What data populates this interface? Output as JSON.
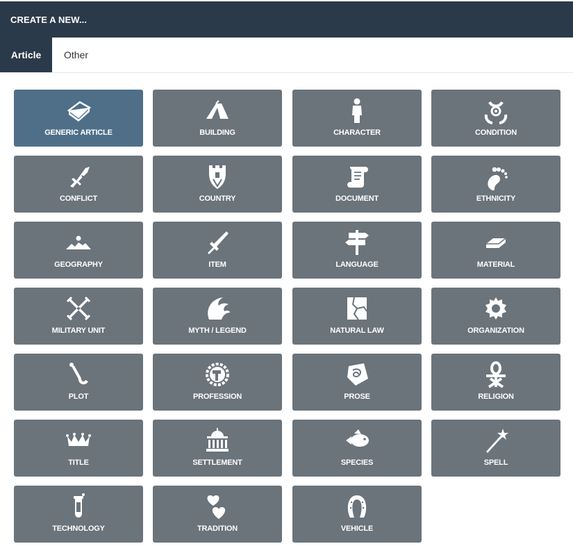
{
  "header": {
    "title": "CREATE A NEW..."
  },
  "tabs": [
    {
      "label": "Article",
      "active": true
    },
    {
      "label": "Other",
      "active": false
    }
  ],
  "colors": {
    "header_bg": "#2b3a4a",
    "tile_bg": "#6b737b",
    "tile_selected_bg": "#4f6f89"
  },
  "tiles": [
    {
      "label": "GENERIC ARTICLE",
      "icon": "book-icon",
      "selected": true
    },
    {
      "label": "BUILDING",
      "icon": "tent-icon"
    },
    {
      "label": "CHARACTER",
      "icon": "person-icon"
    },
    {
      "label": "CONDITION",
      "icon": "biohazard-icon"
    },
    {
      "label": "CONFLICT",
      "icon": "broken-sword-icon"
    },
    {
      "label": "COUNTRY",
      "icon": "castle-shield-icon"
    },
    {
      "label": "DOCUMENT",
      "icon": "scroll-icon"
    },
    {
      "label": "ETHNICITY",
      "icon": "footprint-icon"
    },
    {
      "label": "GEOGRAPHY",
      "icon": "landscape-icon"
    },
    {
      "label": "ITEM",
      "icon": "sword-icon"
    },
    {
      "label": "LANGUAGE",
      "icon": "signpost-icon"
    },
    {
      "label": "MATERIAL",
      "icon": "ingot-icon"
    },
    {
      "label": "MILITARY UNIT",
      "icon": "crossed-swords-icon"
    },
    {
      "label": "MYTH / LEGEND",
      "icon": "hydra-icon"
    },
    {
      "label": "NATURAL LAW",
      "icon": "cracked-stone-icon"
    },
    {
      "label": "ORGANIZATION",
      "icon": "gear-icon"
    },
    {
      "label": "PLOT",
      "icon": "hook-icon"
    },
    {
      "label": "PROFESSION",
      "icon": "hammer-gear-icon"
    },
    {
      "label": "PROSE",
      "icon": "quill-scroll-icon"
    },
    {
      "label": "RELIGION",
      "icon": "ankh-icon"
    },
    {
      "label": "TITLE",
      "icon": "crown-icon"
    },
    {
      "label": "SETTLEMENT",
      "icon": "capitol-icon"
    },
    {
      "label": "SPECIES",
      "icon": "fish-icon"
    },
    {
      "label": "SPELL",
      "icon": "magic-wand-icon"
    },
    {
      "label": "TECHNOLOGY",
      "icon": "test-tube-icon"
    },
    {
      "label": "TRADITION",
      "icon": "hearts-icon"
    },
    {
      "label": "VEHICLE",
      "icon": "horseshoe-icon"
    }
  ]
}
